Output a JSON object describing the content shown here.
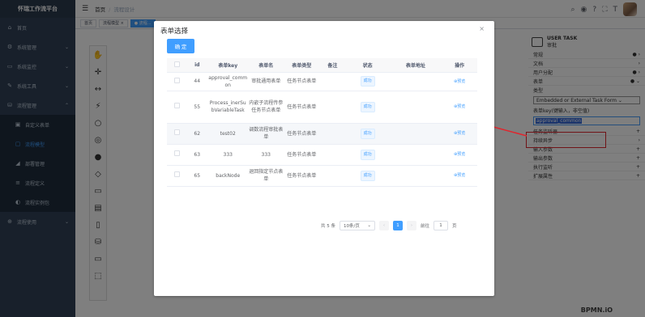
{
  "sidebar": {
    "logo": "怀瑞工作流平台",
    "items": [
      {
        "icon": "home-icon",
        "glyph": "⌂",
        "label": "首页",
        "arrow": ""
      },
      {
        "icon": "gear-icon",
        "glyph": "⚙",
        "label": "系统管理",
        "arrow": "⌄"
      },
      {
        "icon": "monitor-icon",
        "glyph": "▭",
        "label": "系统监控",
        "arrow": "⌄"
      },
      {
        "icon": "tool-icon",
        "glyph": "✎",
        "label": "系统工具",
        "arrow": "⌄"
      },
      {
        "icon": "flow-icon",
        "glyph": "⛁",
        "label": "流程管理",
        "arrow": "⌃"
      }
    ],
    "sub_items": [
      {
        "icon": "form-icon",
        "glyph": "▣",
        "label": "自定义表单"
      },
      {
        "icon": "model-icon",
        "glyph": "▢",
        "label": "流程模型"
      },
      {
        "icon": "deploy-icon",
        "glyph": "◢",
        "label": "部署管理"
      },
      {
        "icon": "define-icon",
        "glyph": "≡",
        "label": "流程定义"
      },
      {
        "icon": "instance-icon",
        "glyph": "◐",
        "label": "流程实例包"
      }
    ],
    "last": {
      "icon": "use-icon",
      "glyph": "⊕",
      "label": "流程使用",
      "arrow": "⌄"
    }
  },
  "navbar": {
    "home": "首页",
    "current": "流程设计"
  },
  "tags": [
    "首页",
    "流程模型 ×",
    "● 流程..."
  ],
  "palette": [
    "✋",
    "✛",
    "↔",
    "⚡",
    "○",
    "◎",
    "●",
    "◇",
    "▭",
    "▤",
    "▯",
    "⛁",
    "▭",
    "⬚"
  ],
  "props": {
    "title": "USER TASK",
    "subtitle": "审批",
    "rows": [
      {
        "label": "常规",
        "mark": "● ›"
      },
      {
        "label": "文档",
        "mark": "›"
      },
      {
        "label": "用户分配",
        "mark": "● ›"
      },
      {
        "label": "表单",
        "mark": "● ⌄"
      }
    ],
    "type_label": "类型",
    "type_value": "Embedded or External Task Form ⌄",
    "key_label": "表单key(键输入，非空值)",
    "key_value": "approval_common",
    "more": [
      {
        "label": "任务监听器",
        "mark": "+"
      },
      {
        "label": "持续异步",
        "mark": "›"
      },
      {
        "label": "输入参数",
        "mark": "+"
      },
      {
        "label": "输出参数",
        "mark": "+"
      },
      {
        "label": "执行监听",
        "mark": "+"
      },
      {
        "label": "扩展属性",
        "mark": "+"
      }
    ],
    "brand": "BPMN.iO"
  },
  "dialog": {
    "title": "表单选择",
    "ok": "确 定",
    "headers": [
      "",
      "id",
      "表单key",
      "表单名",
      "表单类型",
      "备注",
      "状态",
      "表单地址",
      "操作"
    ],
    "rows": [
      {
        "id": "44",
        "key": "approval_common",
        "name": "审批通用表单",
        "type": "任务节点表单",
        "remark": "",
        "status": "成功",
        "addr": "",
        "op": "⊕预览"
      },
      {
        "id": "55",
        "key": "Process_inerSubVariableTask",
        "name": "内嵌子流程传参任务节点表单",
        "type": "任务节点表单",
        "remark": "",
        "status": "成功",
        "addr": "",
        "op": "⊕预览"
      },
      {
        "id": "62",
        "key": "test02",
        "name": "调数流程审批表单",
        "type": "任务节点表单",
        "remark": "",
        "status": "成功",
        "addr": "",
        "op": "⊕预览"
      },
      {
        "id": "63",
        "key": "333",
        "name": "333",
        "type": "任务节点表单",
        "remark": "",
        "status": "成功",
        "addr": "",
        "op": "⊕预览"
      },
      {
        "id": "65",
        "key": "backNode",
        "name": "退回指定节点表单",
        "type": "任务节点表单",
        "remark": "",
        "status": "成功",
        "addr": "",
        "op": "⊕预览"
      }
    ],
    "pager": {
      "total": "共 5 条",
      "size": "10条/页",
      "page": "1",
      "goto": "前往",
      "goto_value": "1",
      "unit": "页"
    }
  }
}
